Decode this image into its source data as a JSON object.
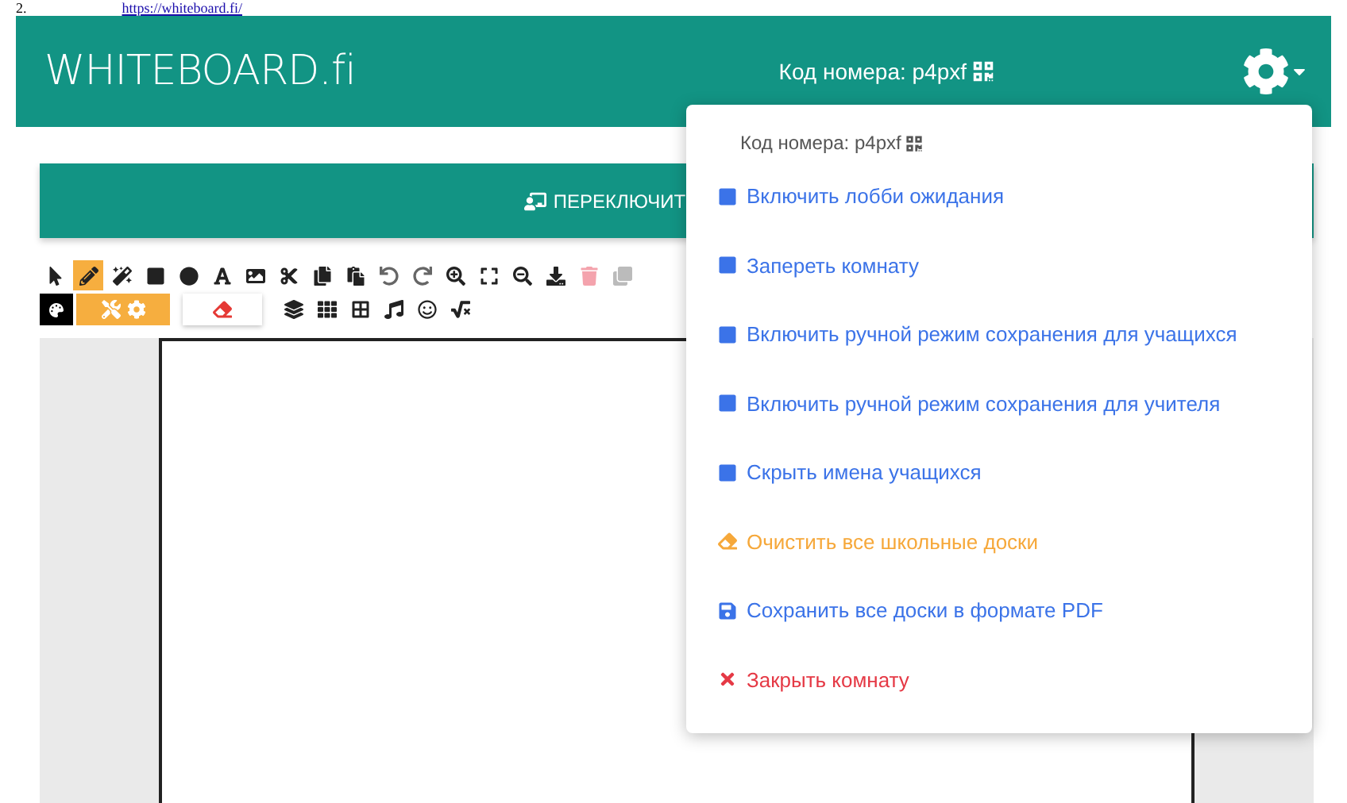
{
  "top_link": {
    "number": "2.",
    "url": "https://whiteboard.fi/"
  },
  "header": {
    "logo": "WHITEBOARD.fi",
    "room_code": "Код номера: p4pxf"
  },
  "switch_button": {
    "label": "ПЕРЕКЛЮЧИТ"
  },
  "toolbar": {
    "tools": [
      {
        "selected": false
      },
      {
        "selected": true
      },
      {
        "selected": false
      },
      {
        "selected": false
      },
      {
        "selected": false
      },
      {
        "selected": false
      },
      {
        "selected": false
      },
      {
        "selected": false
      },
      {
        "selected": false
      },
      {
        "selected": false
      },
      {
        "selected": false
      },
      {
        "selected": false
      },
      {
        "selected": false
      },
      {
        "selected": false
      },
      {
        "selected": false
      },
      {
        "selected": false
      },
      {
        "selected": false
      },
      {
        "selected": false
      }
    ]
  },
  "settings_menu": {
    "room_code": "Код номера: p4pxf",
    "items": [
      {
        "kind": "toggle",
        "label": "Включить лобби ожидания"
      },
      {
        "kind": "toggle",
        "label": "Запереть комнату"
      },
      {
        "kind": "toggle",
        "label": "Включить ручной режим сохранения для учащихся"
      },
      {
        "kind": "toggle",
        "label": "Включить ручной режим сохранения для учителя"
      },
      {
        "kind": "toggle",
        "label": "Скрыть имена учащихся"
      },
      {
        "kind": "clear",
        "label": "Очистить все школьные доски"
      },
      {
        "kind": "save",
        "label": "Сохранить все доски в формате PDF"
      },
      {
        "kind": "close",
        "label": "Закрыть комнату"
      }
    ]
  }
}
